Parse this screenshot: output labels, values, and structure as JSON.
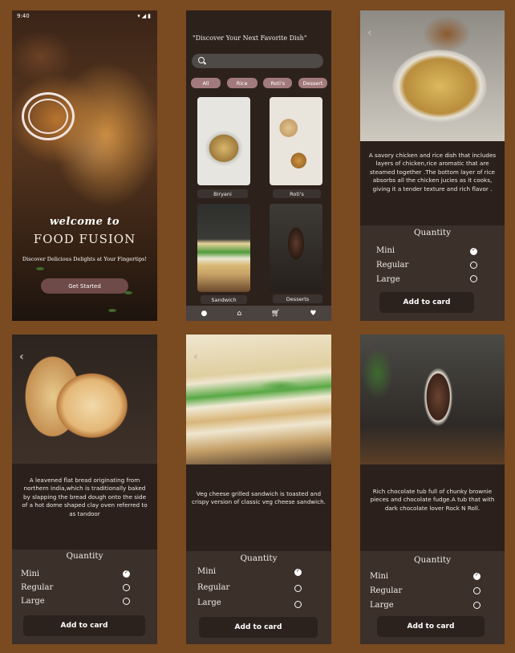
{
  "splash": {
    "time": "9:40",
    "welcome": "welcome   to",
    "brand": "FOOD FUSION",
    "tagline": "Discover Delicious Delights at Your Fingertips!",
    "cta": "Get Started"
  },
  "home": {
    "title": "\"Discover Your Next Favorite Dish\"",
    "search_placeholder": "",
    "categories": [
      "All",
      "Rice",
      "Roti's",
      "Dessert"
    ],
    "cards": [
      "Biryani",
      "Roti's",
      "Sandwich",
      "Desserts"
    ]
  },
  "detail": {
    "quantity_title": "Quantity",
    "options": [
      "Mini",
      "Regular",
      "Large"
    ],
    "add_label": "Add to card"
  },
  "biryani": {
    "description": "A savory chicken and rice dish that includes layers of chicken,rice aromatic that are steamed together .The bottom layer of rice absorbs all the chicken jucies  as it cooks, giving it a tender texture and rich flavor ."
  },
  "naan": {
    "description": "A leavened flat bread originating from northern india,which is traditionally baked by slapping the bread dough onto the side of a hot dome shaped clay oven referred to as tandoor"
  },
  "sandwich": {
    "description": "Veg  cheese grilled sandwich  is toasted and crispy version of classic veg cheese sandwich."
  },
  "dessert": {
    "description": "Rich chocolate tub full of chunky brownie pieces and chocolate  fudge.A tub that with dark chocolate lover Rock N Roll."
  },
  "colors": {
    "background": "#7a4a21",
    "screen": "#2b201b",
    "chip": "#a17a7b",
    "panel": "#3b302a"
  }
}
